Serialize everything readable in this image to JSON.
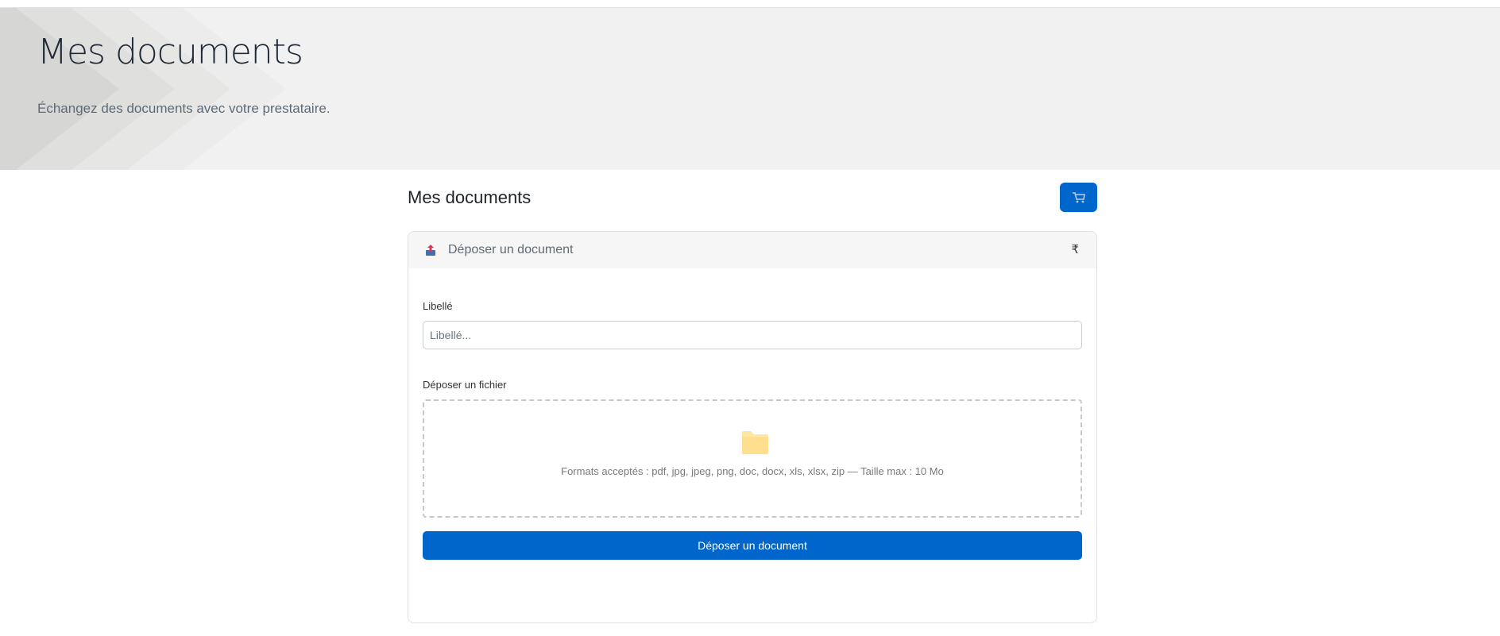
{
  "hero": {
    "title": "Mes documents",
    "subtitle": "Échangez des documents avec votre prestataire."
  },
  "section": {
    "title": "Mes documents",
    "cart_icon": "cart-icon"
  },
  "upload_card": {
    "header_label": "Déposer un document",
    "header_icon": "upload-icon",
    "collapse_icon": "chevron-icon",
    "label_field": {
      "label": "Libellé",
      "value": "",
      "placeholder": "Libellé..."
    },
    "file_field": {
      "label": "Déposer un fichier",
      "icon": "folder-icon",
      "help": "Formats acceptés : pdf, jpg, jpeg, png, doc, docx, xls, xlsx, zip — Taille max : 10 Mo"
    },
    "submit_label": "Déposer un document"
  },
  "colors": {
    "primary": "#0066cc",
    "hero_bg": "#f1f1f1"
  }
}
